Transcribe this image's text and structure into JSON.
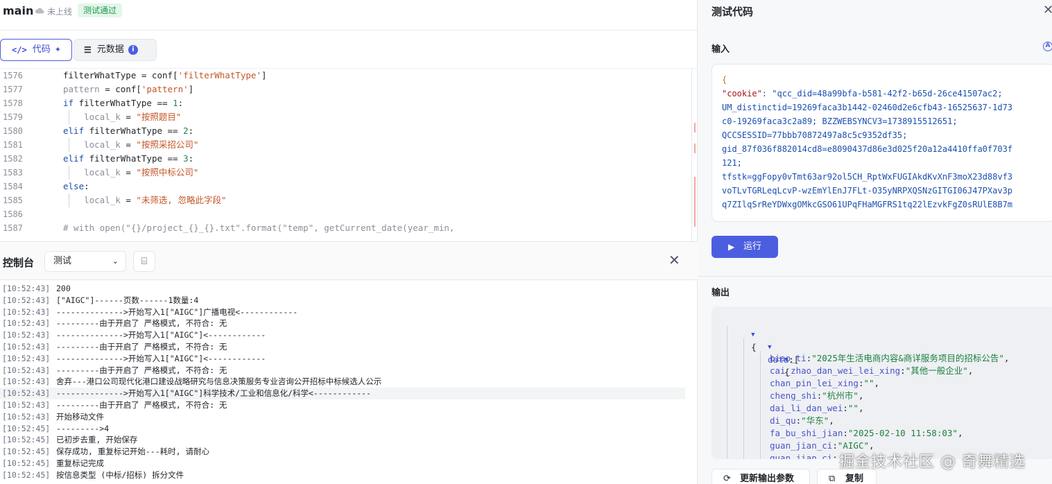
{
  "topbar": {
    "title": "main",
    "status": "未上线",
    "badge": "测试通过"
  },
  "tabs": {
    "code": "代码",
    "meta": "元数据",
    "meta_info": "i"
  },
  "editor": {
    "lines": [
      {
        "n": "1576",
        "parts": [
          [
            "",
            "filterWhatType = conf["
          ],
          [
            "str",
            "'filterWhatType'"
          ],
          [
            "",
            "]"
          ]
        ],
        "guide": false
      },
      {
        "n": "1577",
        "parts": [
          [
            "cmt",
            "pattern"
          ],
          [
            "",
            " = conf["
          ],
          [
            "str",
            "'pattern'"
          ],
          [
            "",
            "]"
          ]
        ],
        "guide": false
      },
      {
        "n": "1578",
        "parts": [
          [
            "kw",
            "if"
          ],
          [
            "",
            " filterWhatType == "
          ],
          [
            "num",
            "1"
          ],
          [
            "",
            ":"
          ]
        ],
        "guide": false
      },
      {
        "n": "1579",
        "parts": [
          [
            "",
            "    "
          ],
          [
            "cmt",
            "local_k"
          ],
          [
            "",
            " = "
          ],
          [
            "str",
            "\"按照题目\""
          ]
        ],
        "guide": true
      },
      {
        "n": "1580",
        "parts": [
          [
            "kw",
            "elif"
          ],
          [
            "",
            " filterWhatType == "
          ],
          [
            "num",
            "2"
          ],
          [
            "",
            ":"
          ]
        ],
        "guide": false
      },
      {
        "n": "1581",
        "parts": [
          [
            "",
            "    "
          ],
          [
            "cmt",
            "local_k"
          ],
          [
            "",
            " = "
          ],
          [
            "str",
            "\"按照采招公司\""
          ]
        ],
        "guide": true
      },
      {
        "n": "1582",
        "parts": [
          [
            "kw",
            "elif"
          ],
          [
            "",
            " filterWhatType == "
          ],
          [
            "num",
            "3"
          ],
          [
            "",
            ":"
          ]
        ],
        "guide": false
      },
      {
        "n": "1583",
        "parts": [
          [
            "",
            "    "
          ],
          [
            "cmt",
            "local_k"
          ],
          [
            "",
            " = "
          ],
          [
            "str",
            "\"按照中标公司\""
          ]
        ],
        "guide": true
      },
      {
        "n": "1584",
        "parts": [
          [
            "kw",
            "else"
          ],
          [
            "",
            ":"
          ]
        ],
        "guide": false
      },
      {
        "n": "1585",
        "parts": [
          [
            "",
            "    "
          ],
          [
            "cmt",
            "local_k"
          ],
          [
            "",
            " = "
          ],
          [
            "str",
            "\"未筛选, 忽略此字段\""
          ]
        ],
        "guide": true
      },
      {
        "n": "1586",
        "parts": [
          [
            "",
            ""
          ]
        ],
        "guide": false
      },
      {
        "n": "1587",
        "parts": [
          [
            "cmt",
            "# with open(\"{}/project_{}_{}.txt\".format(\"temp\", getCurrent_date(year_min,"
          ]
        ],
        "guide": false
      }
    ]
  },
  "console": {
    "title": "控制台",
    "select_value": "测试",
    "logs": [
      {
        "ts": "[10:52:43]",
        "msg": "200"
      },
      {
        "ts": "[10:52:43]",
        "msg": "[\"AIGC\"]------页数------1数量:4"
      },
      {
        "ts": "[10:52:43]",
        "msg": "-------------->开始写入1[\"AIGC\"]广播电视<------------"
      },
      {
        "ts": "[10:52:43]",
        "msg": "---------由于开启了 严格模式, 不符合: 无"
      },
      {
        "ts": "[10:52:43]",
        "msg": "-------------->开始写入1[\"AIGC\"]<------------"
      },
      {
        "ts": "[10:52:43]",
        "msg": "---------由于开启了 严格模式, 不符合: 无"
      },
      {
        "ts": "[10:52:43]",
        "msg": "-------------->开始写入1[\"AIGC\"]<------------"
      },
      {
        "ts": "[10:52:43]",
        "msg": "---------由于开启了 严格模式, 不符合: 无"
      },
      {
        "ts": "[10:52:43]",
        "msg": "舍弃---港口公司现代化港口建设战略研究与信息决策服务专业咨询公开招标中标候选人公示"
      },
      {
        "ts": "[10:52:43]",
        "msg": "-------------->开始写入1[\"AIGC\"]科学技术/工业和信息化/科学<------------"
      },
      {
        "ts": "[10:52:43]",
        "msg": "---------由于开启了 严格模式, 不符合: 无"
      },
      {
        "ts": "[10:52:43]",
        "msg": "开始移动文件"
      },
      {
        "ts": "[10:52:45]",
        "msg": "--------->4"
      },
      {
        "ts": "[10:52:45]",
        "msg": "已初步去重, 开始保存"
      },
      {
        "ts": "[10:52:45]",
        "msg": "保存成功, 重复标记开始---耗时, 请耐心"
      },
      {
        "ts": "[10:52:45]",
        "msg": "重复标记完成"
      },
      {
        "ts": "[10:52:45]",
        "msg": "按信息类型 (中标/招标) 拆分文件"
      }
    ]
  },
  "right": {
    "title": "测试代码",
    "input_label": "输入",
    "input_lines": [
      [
        "brace",
        "{"
      ],
      [
        "kv",
        "\"cookie\"",
        ": \"qcc_did=48a99bfa-b581-42f2-b65d-26ce41507ac2;"
      ],
      [
        "val",
        "UM_distinctid=19269faca3b1442-02460d2e6cfb43-16525637-1d73"
      ],
      [
        "val",
        "c0-19269faca3c2a89; BZZWEBSYNCV3=1738915512651;"
      ],
      [
        "val",
        "QCCSESSID=77bbb70872497a8c5c9352df35;"
      ],
      [
        "val",
        "gid_87f036f882014cd8=e8090437d86e3d025f20a12a4410ffa0f703f"
      ],
      [
        "val",
        "121;"
      ],
      [
        "val",
        "tfstk=ggFopy0vTmt63ar92ol5CH_RptWxFUGIAkdKvXnF3moX23d88vf3"
      ],
      [
        "val",
        "voTLvTGRLeqLcvP-wzEmYlEnJ7FLt-O35yNRPXQSNzGITGI06J47PXav3p"
      ],
      [
        "val",
        "q7ZIlqSrReYDWxgOMkcGSO61UPqFHaMGFRS1tq22lEzvkFgZ0sRUlE8B7m"
      ]
    ],
    "run_label": "运行",
    "output_label": "输出",
    "output": {
      "root_open": "{",
      "data_key": "data",
      "data_open": ":[",
      "item_open": "{",
      "fields": [
        {
          "k": "biao_ti",
          "v": "\"2025年生活电商内容&商详服务项目的招标公告\""
        },
        {
          "k": "cai_zhao_dan_wei_lei_xing",
          "v": "\"其他一般企业\""
        },
        {
          "k": "chan_pin_lei_xing",
          "v": "\"\""
        },
        {
          "k": "cheng_shi",
          "v": "\"杭州市\""
        },
        {
          "k": "dai_li_dan_wei",
          "v": "\"\""
        },
        {
          "k": "di_qu",
          "v": "\"华东\""
        },
        {
          "k": "fa_bu_shi_jian",
          "v": "\"2025-02-10 11:58:03\""
        },
        {
          "k": "guan_jian_ci",
          "v": "\"AIGC\""
        },
        {
          "k": "guan_jian_ci",
          "v": ""
        }
      ]
    },
    "update_btn": "更新输出参数",
    "copy_btn": "复制"
  },
  "watermark": "掘金技术社区 @ 奇舞精选"
}
